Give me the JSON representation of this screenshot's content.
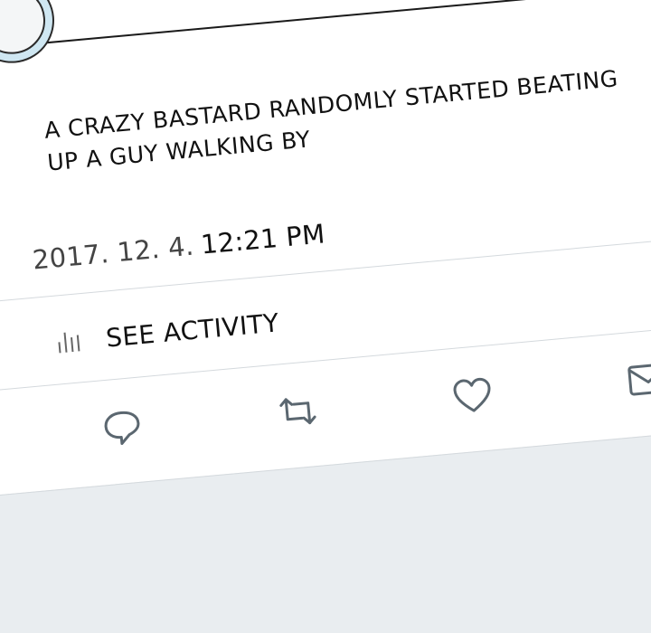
{
  "tweet": {
    "text_line1": "A CRAZY BASTARD RANDOMLY STARTED BEATING",
    "text_line2": "UP A GUY WALKING BY",
    "date": "2017. 12. 4.",
    "time": "12:21 PM"
  },
  "activity": {
    "label": "SEE ACTIVITY",
    "icon": "bar-chart-icon"
  },
  "actions": [
    {
      "name": "reply",
      "icon": "speech-bubble-icon"
    },
    {
      "name": "retweet",
      "icon": "retweet-icon"
    },
    {
      "name": "like",
      "icon": "heart-icon"
    },
    {
      "name": "direct-message",
      "icon": "envelope-icon"
    }
  ],
  "colors": {
    "background": "#e9edf0",
    "card": "#ffffff",
    "text": "#111111",
    "icon_stroke": "#5b6770",
    "avatar": "#cfe7f2"
  }
}
